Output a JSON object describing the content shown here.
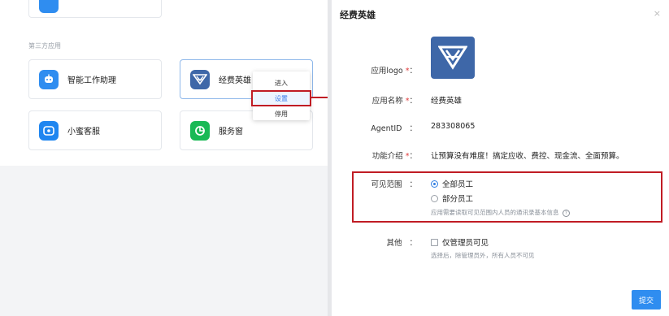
{
  "left": {
    "section_title": "第三方应用",
    "apps": [
      {
        "name": "智能工作助理",
        "icon": "robot-icon",
        "color": "#2f8df0"
      },
      {
        "name": "经费英雄",
        "icon": "hero-logo-icon",
        "color": "#3e67a8"
      },
      {
        "name": "小蜜客服",
        "icon": "service-icon",
        "color": "#1f86f0"
      },
      {
        "name": "服务窗",
        "icon": "window-icon",
        "color": "#19b955"
      }
    ],
    "top_partial": "  ",
    "dropdown": {
      "items": [
        "进入",
        "设置",
        "停用"
      ]
    }
  },
  "dialog": {
    "title": "经费英雄",
    "close": "×",
    "logo_label": "应用logo",
    "name_label": "应用名称",
    "name_value": "经费英雄",
    "agentid_label": "AgentID",
    "agentid_value": "283308065",
    "intro_label": "功能介绍",
    "intro_value": "让预算没有难度！搞定应收、费控、现金流、全面预算。",
    "scope_label": "可见范围",
    "scope_all": "全部员工",
    "scope_part": "部分员工",
    "scope_hint": "应用需要读取可见范围内人员的通讯录基本信息",
    "other_label": "其他",
    "admin_only": "仅管理员可见",
    "admin_hint": "选择后，除管理员外，所有人员不可见",
    "colon": "：",
    "required": "*",
    "submit": "提交"
  }
}
